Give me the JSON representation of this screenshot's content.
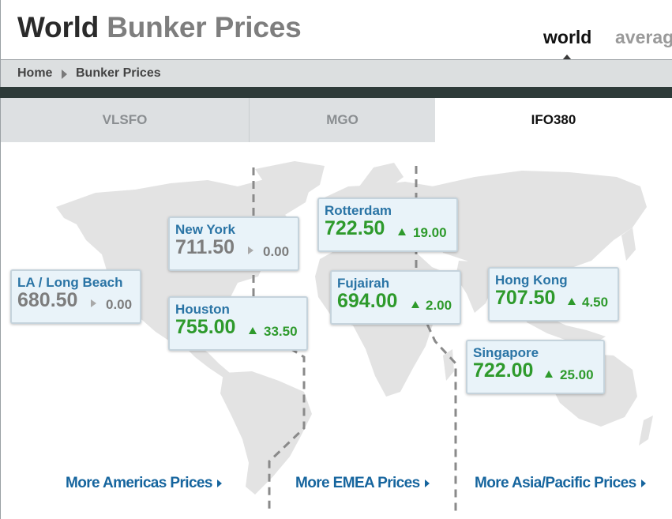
{
  "header": {
    "title_primary": "World",
    "title_secondary": "Bunker Prices",
    "tabs": [
      {
        "label": "world",
        "active": true
      },
      {
        "label": "averag",
        "active": false
      }
    ]
  },
  "breadcrumb": {
    "home": "Home",
    "current": "Bunker Prices"
  },
  "product_tabs": [
    {
      "label": "VLSFO",
      "active": false
    },
    {
      "label": "MGO",
      "active": false
    },
    {
      "label": "IFO380",
      "active": true
    }
  ],
  "ports": [
    {
      "name": "LA / Long Beach",
      "price": "680.50",
      "change": "0.00",
      "trend": "flat"
    },
    {
      "name": "New York",
      "price": "711.50",
      "change": "0.00",
      "trend": "flat"
    },
    {
      "name": "Houston",
      "price": "755.00",
      "change": "33.50",
      "trend": "up"
    },
    {
      "name": "Rotterdam",
      "price": "722.50",
      "change": "19.00",
      "trend": "up"
    },
    {
      "name": "Fujairah",
      "price": "694.00",
      "change": "2.00",
      "trend": "up"
    },
    {
      "name": "Hong Kong",
      "price": "707.50",
      "change": "4.50",
      "trend": "up"
    },
    {
      "name": "Singapore",
      "price": "722.00",
      "change": "25.00",
      "trend": "up"
    }
  ],
  "region_links": {
    "americas": "More Americas Prices",
    "emea": "More EMEA Prices",
    "asia": "More Asia/Pacific Prices"
  },
  "colors": {
    "up": "#2e9a2c",
    "flat": "#7d7d7d",
    "city": "#2a74a5",
    "link": "#16659e",
    "dark_band": "#2e3b39"
  },
  "icons": {
    "breadcrumb_separator": "chevron-right-icon",
    "trend_up": "triangle-up-icon",
    "trend_flat": "triangle-right-icon",
    "link_caret": "caret-right-icon"
  }
}
